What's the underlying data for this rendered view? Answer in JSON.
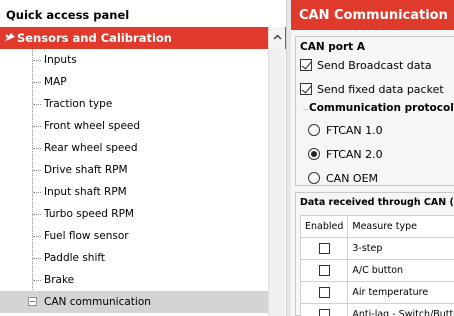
{
  "left_panel": {
    "header": "Quick access panel",
    "section_title": "Sensors and Calibration",
    "items": [
      {
        "label": "Inputs"
      },
      {
        "label": "MAP"
      },
      {
        "label": "Traction type"
      },
      {
        "label": "Front wheel speed"
      },
      {
        "label": "Rear wheel speed"
      },
      {
        "label": "Drive shaft RPM"
      },
      {
        "label": "Input shaft RPM"
      },
      {
        "label": "Turbo speed RPM"
      },
      {
        "label": "Fuel flow sensor"
      },
      {
        "label": "Paddle shift"
      },
      {
        "label": "Brake"
      },
      {
        "label": "CAN communication",
        "expander": "−",
        "selected": true
      }
    ]
  },
  "right_panel": {
    "title": "CAN Communication",
    "can_port": {
      "title": "CAN port A",
      "send_broadcast": {
        "label": "Send Broadcast data",
        "checked": true
      },
      "send_fixed": {
        "label": "Send fixed data packet",
        "checked": true
      },
      "protocol_title": "Communication protocol",
      "options": [
        {
          "label": "FTCAN 1.0",
          "checked": false
        },
        {
          "label": "FTCAN 2.0",
          "checked": true
        },
        {
          "label": "CAN OEM",
          "checked": false
        }
      ]
    },
    "data_received": {
      "title": "Data received through CAN (",
      "columns": [
        "Enabled",
        "Measure type"
      ],
      "rows": [
        {
          "measure": "3-step"
        },
        {
          "measure": "A/C button"
        },
        {
          "measure": "Air temperature"
        },
        {
          "measure": "Anti-lag - Switch/Butto"
        }
      ]
    }
  },
  "colors": {
    "accent": "#e03a2c",
    "selected_row": "#d4d4d4"
  }
}
